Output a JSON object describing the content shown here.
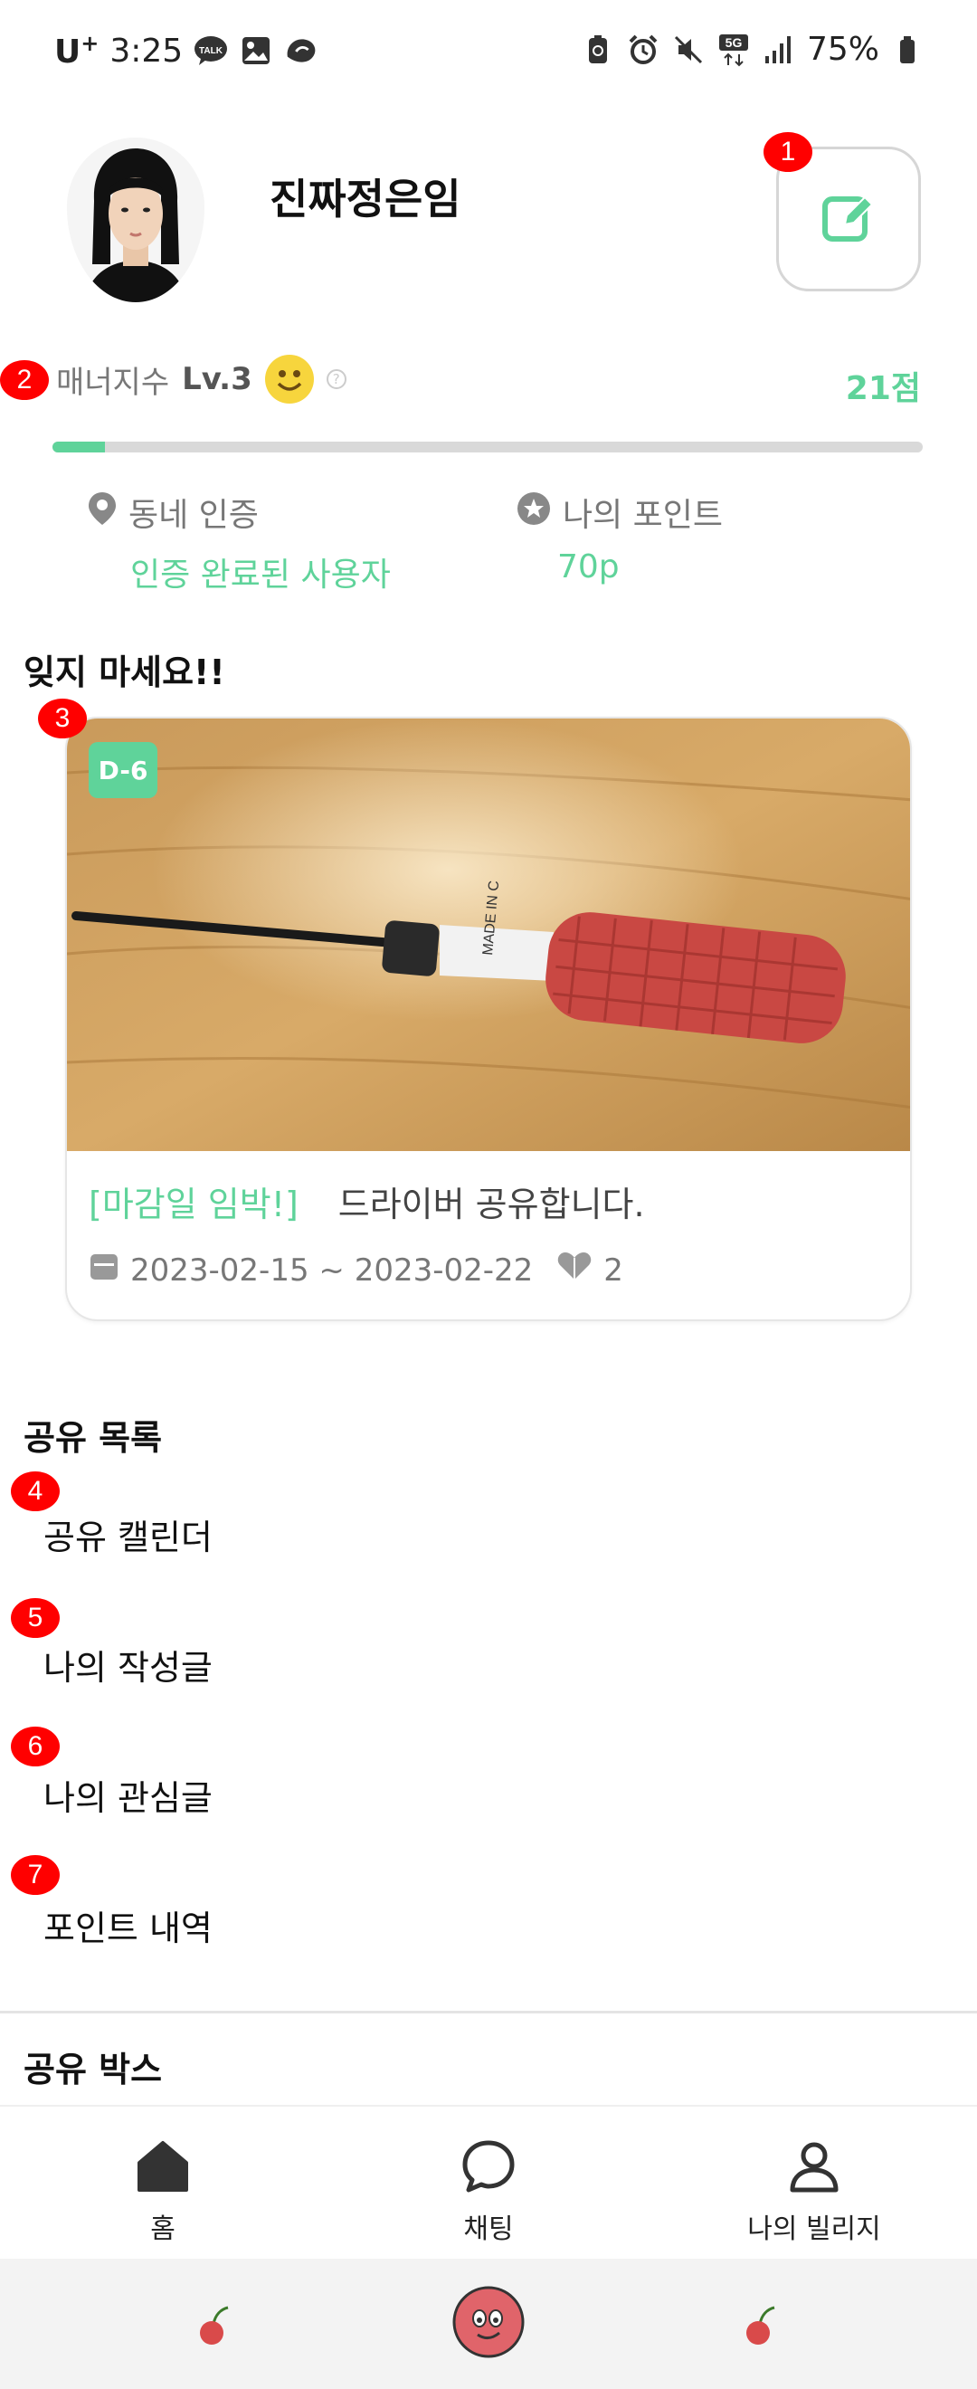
{
  "status_bar": {
    "carrier": "U",
    "carrier_sup": "+",
    "time": "3:25",
    "battery": "75%"
  },
  "profile": {
    "nickname": "진짜정은임"
  },
  "badges": [
    "1",
    "2",
    "3",
    "4",
    "5",
    "6",
    "7"
  ],
  "manner": {
    "label": "매너지수",
    "level": "Lv.3",
    "score": "21점",
    "progress_fraction": 0.06
  },
  "info": {
    "neighborhood_title": "동네 인증",
    "neighborhood_value": "인증 완료된 사용자",
    "points_title": "나의 포인트",
    "points_value": "70p"
  },
  "reminder": {
    "section_title": "잊지 마세요!!",
    "dday": "D-6",
    "deadline_tag": "[마감일 임박!]",
    "post_title": "드라이버 공유합니다.",
    "date_range": "2023-02-15 ~ 2023-02-22",
    "likes": "2"
  },
  "share_list": {
    "section_title": "공유 목록",
    "items": [
      "공유 캘린더",
      "나의 작성글",
      "나의 관심글",
      "포인트 내역"
    ]
  },
  "share_box": {
    "section_title": "공유 박스"
  },
  "bottom_nav": {
    "items": [
      "홈",
      "채팅",
      "나의 빌리지"
    ]
  },
  "colors": {
    "accent": "#5fd39a",
    "badge": "#ff0000"
  },
  "icons": [
    "location-pin-icon",
    "star-badge-icon",
    "pencil-edit-icon",
    "calendar-icon",
    "heart-icon",
    "home-icon",
    "chat-icon",
    "person-icon"
  ]
}
